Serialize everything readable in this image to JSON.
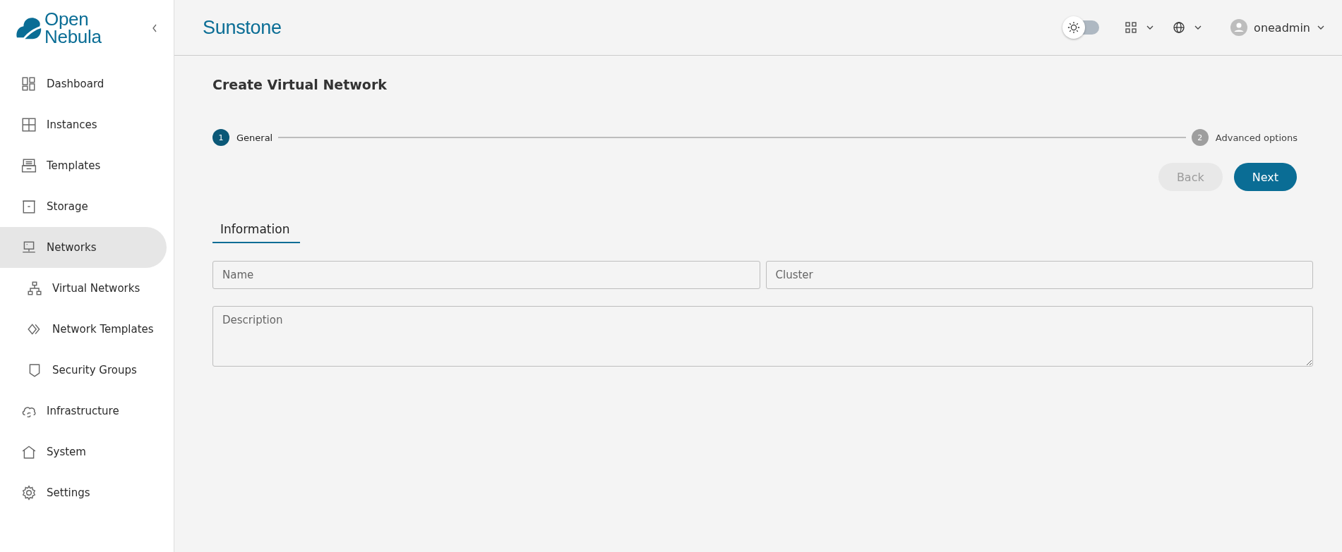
{
  "logo": {
    "text": "Open Nebula"
  },
  "sidebar": {
    "items": [
      {
        "label": "Dashboard",
        "selected": false
      },
      {
        "label": "Instances",
        "selected": false
      },
      {
        "label": "Templates",
        "selected": false
      },
      {
        "label": "Storage",
        "selected": false
      },
      {
        "label": "Networks",
        "selected": true,
        "children": [
          {
            "label": "Virtual Networks",
            "selected": false
          },
          {
            "label": "Network Templates",
            "selected": false
          },
          {
            "label": "Security Groups",
            "selected": false
          }
        ]
      },
      {
        "label": "Infrastructure",
        "selected": false
      },
      {
        "label": "System",
        "selected": false
      },
      {
        "label": "Settings",
        "selected": false
      }
    ]
  },
  "header": {
    "title": "Sunstone",
    "theme_toggle": {
      "on": false
    },
    "user": "oneadmin"
  },
  "page": {
    "title": "Create Virtual Network",
    "steps": [
      {
        "number": "1",
        "label": "General",
        "selected": true
      },
      {
        "number": "2",
        "label": "Advanced options",
        "selected": false
      }
    ],
    "buttons": [
      {
        "label": "Back",
        "disabled": true
      },
      {
        "label": "Next",
        "disabled": false
      }
    ],
    "tabs": [
      {
        "label": "Information",
        "selected": true
      }
    ],
    "fields": [
      {
        "placeholder": "Name",
        "kind": "text"
      },
      {
        "placeholder": "Cluster",
        "kind": "text"
      },
      {
        "placeholder": "Description",
        "kind": "textarea"
      }
    ]
  }
}
